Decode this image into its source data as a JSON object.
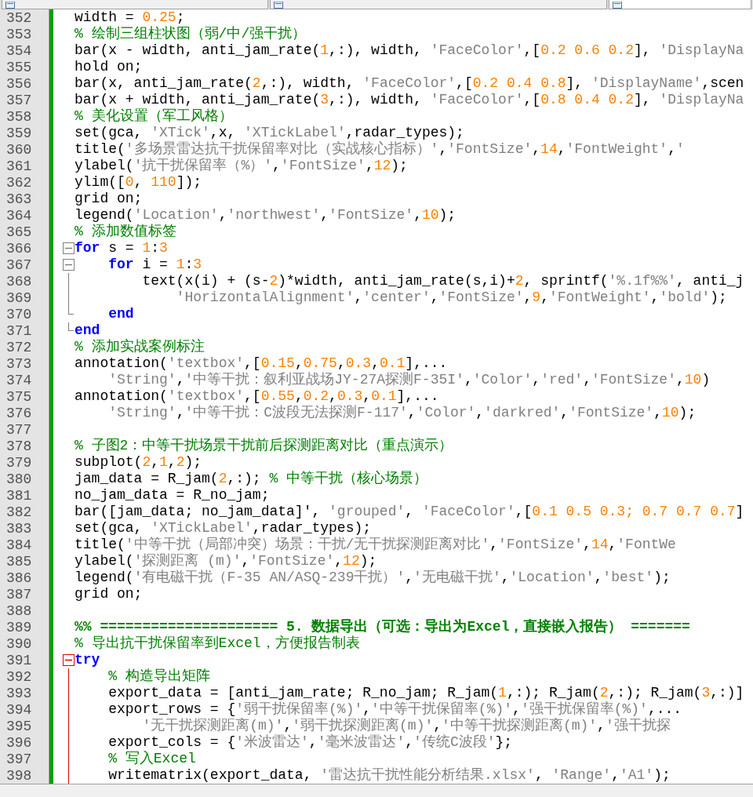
{
  "tabs": [
    {
      "selected": false
    },
    {
      "selected": false
    },
    {
      "selected": true
    }
  ],
  "lines": [
    {
      "number": "352",
      "tokens": [
        {
          "kind": "plain",
          "text": "width = "
        },
        {
          "kind": "num",
          "text": "0.25"
        },
        {
          "kind": "plain",
          "text": ";"
        }
      ]
    },
    {
      "number": "353",
      "tokens": [
        {
          "kind": "cmt",
          "text": "% 绘制三组柱状图（弱/中/强干扰）"
        }
      ]
    },
    {
      "number": "354",
      "tokens": [
        {
          "kind": "plain",
          "text": "bar(x - width, anti_jam_rate("
        },
        {
          "kind": "num",
          "text": "1"
        },
        {
          "kind": "plain",
          "text": ",:), width, "
        },
        {
          "kind": "str",
          "text": "'FaceColor'"
        },
        {
          "kind": "plain",
          "text": ",["
        },
        {
          "kind": "num",
          "text": "0.2 0.6 0.2"
        },
        {
          "kind": "plain",
          "text": "], "
        },
        {
          "kind": "str",
          "text": "'DisplayNa"
        }
      ]
    },
    {
      "number": "355",
      "tokens": [
        {
          "kind": "plain",
          "text": "hold on;"
        }
      ]
    },
    {
      "number": "356",
      "tokens": [
        {
          "kind": "plain",
          "text": "bar(x, anti_jam_rate("
        },
        {
          "kind": "num",
          "text": "2"
        },
        {
          "kind": "plain",
          "text": ",:), width, "
        },
        {
          "kind": "str",
          "text": "'FaceColor'"
        },
        {
          "kind": "plain",
          "text": ",["
        },
        {
          "kind": "num",
          "text": "0.2 0.4 0.8"
        },
        {
          "kind": "plain",
          "text": "], "
        },
        {
          "kind": "str",
          "text": "'DisplayName'"
        },
        {
          "kind": "plain",
          "text": ",scen"
        }
      ]
    },
    {
      "number": "357",
      "tokens": [
        {
          "kind": "plain",
          "text": "bar(x + width, anti_jam_rate("
        },
        {
          "kind": "num",
          "text": "3"
        },
        {
          "kind": "plain",
          "text": ",:), width, "
        },
        {
          "kind": "str",
          "text": "'FaceColor'"
        },
        {
          "kind": "plain",
          "text": ",["
        },
        {
          "kind": "num",
          "text": "0.8 0.4 0.2"
        },
        {
          "kind": "plain",
          "text": "], "
        },
        {
          "kind": "str",
          "text": "'DisplayNa"
        }
      ]
    },
    {
      "number": "358",
      "tokens": [
        {
          "kind": "cmt",
          "text": "% 美化设置（军工风格）"
        }
      ]
    },
    {
      "number": "359",
      "tokens": [
        {
          "kind": "plain",
          "text": "set(gca, "
        },
        {
          "kind": "str",
          "text": "'XTick'"
        },
        {
          "kind": "plain",
          "text": ",x, "
        },
        {
          "kind": "str",
          "text": "'XTickLabel'"
        },
        {
          "kind": "plain",
          "text": ",radar_types);"
        }
      ]
    },
    {
      "number": "360",
      "tokens": [
        {
          "kind": "plain",
          "text": "title("
        },
        {
          "kind": "str",
          "text": "'多场景雷达抗干扰保留率对比（实战核心指标）'"
        },
        {
          "kind": "plain",
          "text": ","
        },
        {
          "kind": "str",
          "text": "'FontSize'"
        },
        {
          "kind": "plain",
          "text": ","
        },
        {
          "kind": "num",
          "text": "14"
        },
        {
          "kind": "plain",
          "text": ","
        },
        {
          "kind": "str",
          "text": "'FontWeight'"
        },
        {
          "kind": "plain",
          "text": ","
        },
        {
          "kind": "str",
          "text": "'"
        }
      ]
    },
    {
      "number": "361",
      "tokens": [
        {
          "kind": "plain",
          "text": "ylabel("
        },
        {
          "kind": "str",
          "text": "'抗干扰保留率（%）'"
        },
        {
          "kind": "plain",
          "text": ","
        },
        {
          "kind": "str",
          "text": "'FontSize'"
        },
        {
          "kind": "plain",
          "text": ","
        },
        {
          "kind": "num",
          "text": "12"
        },
        {
          "kind": "plain",
          "text": ");"
        }
      ]
    },
    {
      "number": "362",
      "tokens": [
        {
          "kind": "plain",
          "text": "ylim(["
        },
        {
          "kind": "num",
          "text": "0"
        },
        {
          "kind": "plain",
          "text": ", "
        },
        {
          "kind": "num",
          "text": "110"
        },
        {
          "kind": "plain",
          "text": "]);"
        }
      ]
    },
    {
      "number": "363",
      "tokens": [
        {
          "kind": "plain",
          "text": "grid on;"
        }
      ]
    },
    {
      "number": "364",
      "tokens": [
        {
          "kind": "plain",
          "text": "legend("
        },
        {
          "kind": "str",
          "text": "'Location'"
        },
        {
          "kind": "plain",
          "text": ","
        },
        {
          "kind": "str",
          "text": "'northwest'"
        },
        {
          "kind": "plain",
          "text": ","
        },
        {
          "kind": "str",
          "text": "'FontSize'"
        },
        {
          "kind": "plain",
          "text": ","
        },
        {
          "kind": "num",
          "text": "10"
        },
        {
          "kind": "plain",
          "text": ");"
        }
      ]
    },
    {
      "number": "365",
      "tokens": [
        {
          "kind": "cmt",
          "text": "% 添加数值标签"
        }
      ]
    },
    {
      "number": "366",
      "fold": {
        "kind": "start",
        "active": false
      },
      "tokens": [
        {
          "kind": "kw",
          "text": "for"
        },
        {
          "kind": "plain",
          "text": " s = "
        },
        {
          "kind": "num",
          "text": "1"
        },
        {
          "kind": "plain",
          "text": ":"
        },
        {
          "kind": "num",
          "text": "3"
        }
      ]
    },
    {
      "number": "367",
      "fold": {
        "kind": "start",
        "active": false
      },
      "tokens": [
        {
          "kind": "kw",
          "text": "    for"
        },
        {
          "kind": "plain",
          "text": " i = "
        },
        {
          "kind": "num",
          "text": "1"
        },
        {
          "kind": "plain",
          "text": ":"
        },
        {
          "kind": "num",
          "text": "3"
        }
      ]
    },
    {
      "number": "368",
      "tokens": [
        {
          "kind": "plain",
          "text": "        text(x(i) + (s-"
        },
        {
          "kind": "num",
          "text": "2"
        },
        {
          "kind": "plain",
          "text": ")*width, anti_jam_rate(s,i)+"
        },
        {
          "kind": "num",
          "text": "2"
        },
        {
          "kind": "plain",
          "text": ", sprintf("
        },
        {
          "kind": "str",
          "text": "'%.1f%%'"
        },
        {
          "kind": "plain",
          "text": ", anti_j"
        }
      ]
    },
    {
      "number": "369",
      "tokens": [
        {
          "kind": "str",
          "text": "            'HorizontalAlignment'"
        },
        {
          "kind": "plain",
          "text": ","
        },
        {
          "kind": "str",
          "text": "'center'"
        },
        {
          "kind": "plain",
          "text": ","
        },
        {
          "kind": "str",
          "text": "'FontSize'"
        },
        {
          "kind": "plain",
          "text": ","
        },
        {
          "kind": "num",
          "text": "9"
        },
        {
          "kind": "plain",
          "text": ","
        },
        {
          "kind": "str",
          "text": "'FontWeight'"
        },
        {
          "kind": "plain",
          "text": ","
        },
        {
          "kind": "str",
          "text": "'bold'"
        },
        {
          "kind": "plain",
          "text": ");"
        }
      ]
    },
    {
      "number": "370",
      "fold": {
        "kind": "end",
        "active": false
      },
      "tokens": [
        {
          "kind": "kw",
          "text": "    end"
        }
      ]
    },
    {
      "number": "371",
      "fold": {
        "kind": "end",
        "active": false
      },
      "tokens": [
        {
          "kind": "kw",
          "text": "end"
        }
      ]
    },
    {
      "number": "372",
      "tokens": [
        {
          "kind": "cmt",
          "text": "% 添加实战案例标注"
        }
      ]
    },
    {
      "number": "373",
      "tokens": [
        {
          "kind": "plain",
          "text": "annotation("
        },
        {
          "kind": "str",
          "text": "'textbox'"
        },
        {
          "kind": "plain",
          "text": ",["
        },
        {
          "kind": "num",
          "text": "0.15"
        },
        {
          "kind": "plain",
          "text": ","
        },
        {
          "kind": "num",
          "text": "0.75"
        },
        {
          "kind": "plain",
          "text": ","
        },
        {
          "kind": "num",
          "text": "0.3"
        },
        {
          "kind": "plain",
          "text": ","
        },
        {
          "kind": "num",
          "text": "0.1"
        },
        {
          "kind": "plain",
          "text": "],..."
        }
      ]
    },
    {
      "number": "374",
      "tokens": [
        {
          "kind": "str",
          "text": "    'String'"
        },
        {
          "kind": "plain",
          "text": ","
        },
        {
          "kind": "str",
          "text": "'中等干扰：叙利亚战场JY-27A探测F-35I'"
        },
        {
          "kind": "plain",
          "text": ","
        },
        {
          "kind": "str",
          "text": "'Color'"
        },
        {
          "kind": "plain",
          "text": ","
        },
        {
          "kind": "str",
          "text": "'red'"
        },
        {
          "kind": "plain",
          "text": ","
        },
        {
          "kind": "str",
          "text": "'FontSize'"
        },
        {
          "kind": "plain",
          "text": ","
        },
        {
          "kind": "num",
          "text": "10"
        },
        {
          "kind": "plain",
          "text": ")"
        }
      ]
    },
    {
      "number": "375",
      "tokens": [
        {
          "kind": "plain",
          "text": "annotation("
        },
        {
          "kind": "str",
          "text": "'textbox'"
        },
        {
          "kind": "plain",
          "text": ",["
        },
        {
          "kind": "num",
          "text": "0.55"
        },
        {
          "kind": "plain",
          "text": ","
        },
        {
          "kind": "num",
          "text": "0.2"
        },
        {
          "kind": "plain",
          "text": ","
        },
        {
          "kind": "num",
          "text": "0.3"
        },
        {
          "kind": "plain",
          "text": ","
        },
        {
          "kind": "num",
          "text": "0.1"
        },
        {
          "kind": "plain",
          "text": "],..."
        }
      ]
    },
    {
      "number": "376",
      "tokens": [
        {
          "kind": "str",
          "text": "    'String'"
        },
        {
          "kind": "plain",
          "text": ","
        },
        {
          "kind": "str",
          "text": "'中等干扰：C波段无法探测F-117'"
        },
        {
          "kind": "plain",
          "text": ","
        },
        {
          "kind": "str",
          "text": "'Color'"
        },
        {
          "kind": "plain",
          "text": ","
        },
        {
          "kind": "str",
          "text": "'darkred'"
        },
        {
          "kind": "plain",
          "text": ","
        },
        {
          "kind": "str",
          "text": "'FontSize'"
        },
        {
          "kind": "plain",
          "text": ","
        },
        {
          "kind": "num",
          "text": "10"
        },
        {
          "kind": "plain",
          "text": ");"
        }
      ]
    },
    {
      "number": "377"
    },
    {
      "number": "378",
      "tokens": [
        {
          "kind": "cmt",
          "text": "% 子图2：中等干扰场景干扰前后探测距离对比（重点演示）"
        }
      ]
    },
    {
      "number": "379",
      "tokens": [
        {
          "kind": "plain",
          "text": "subplot("
        },
        {
          "kind": "num",
          "text": "2"
        },
        {
          "kind": "plain",
          "text": ","
        },
        {
          "kind": "num",
          "text": "1"
        },
        {
          "kind": "plain",
          "text": ","
        },
        {
          "kind": "num",
          "text": "2"
        },
        {
          "kind": "plain",
          "text": ");"
        }
      ]
    },
    {
      "number": "380",
      "tokens": [
        {
          "kind": "plain",
          "text": "jam_data = R_jam("
        },
        {
          "kind": "num",
          "text": "2"
        },
        {
          "kind": "plain",
          "text": ",:); "
        },
        {
          "kind": "cmt",
          "text": "% 中等干扰（核心场景）"
        }
      ]
    },
    {
      "number": "381",
      "tokens": [
        {
          "kind": "plain",
          "text": "no_jam_data = R_no_jam;"
        }
      ]
    },
    {
      "number": "382",
      "tokens": [
        {
          "kind": "plain",
          "text": "bar([jam_data; no_jam_data]', "
        },
        {
          "kind": "str",
          "text": "'grouped'"
        },
        {
          "kind": "plain",
          "text": ", "
        },
        {
          "kind": "str",
          "text": "'FaceColor'"
        },
        {
          "kind": "plain",
          "text": ",["
        },
        {
          "kind": "num",
          "text": "0.1 0.5 0.3; 0.7 0.7 0.7"
        },
        {
          "kind": "plain",
          "text": "]"
        }
      ]
    },
    {
      "number": "383",
      "tokens": [
        {
          "kind": "plain",
          "text": "set(gca, "
        },
        {
          "kind": "str",
          "text": "'XTickLabel'"
        },
        {
          "kind": "plain",
          "text": ",radar_types);"
        }
      ]
    },
    {
      "number": "384",
      "tokens": [
        {
          "kind": "plain",
          "text": "title("
        },
        {
          "kind": "str",
          "text": "'中等干扰（局部冲突）场景：干扰/无干扰探测距离对比'"
        },
        {
          "kind": "plain",
          "text": ","
        },
        {
          "kind": "str",
          "text": "'FontSize'"
        },
        {
          "kind": "plain",
          "text": ","
        },
        {
          "kind": "num",
          "text": "14"
        },
        {
          "kind": "plain",
          "text": ","
        },
        {
          "kind": "str",
          "text": "'FontWe"
        }
      ]
    },
    {
      "number": "385",
      "tokens": [
        {
          "kind": "plain",
          "text": "ylabel("
        },
        {
          "kind": "str",
          "text": "'探测距离 (m)'"
        },
        {
          "kind": "plain",
          "text": ","
        },
        {
          "kind": "str",
          "text": "'FontSize'"
        },
        {
          "kind": "plain",
          "text": ","
        },
        {
          "kind": "num",
          "text": "12"
        },
        {
          "kind": "plain",
          "text": ");"
        }
      ]
    },
    {
      "number": "386",
      "tokens": [
        {
          "kind": "plain",
          "text": "legend("
        },
        {
          "kind": "str",
          "text": "'有电磁干扰（F-35 AN/ASQ-239干扰）'"
        },
        {
          "kind": "plain",
          "text": ","
        },
        {
          "kind": "str",
          "text": "'无电磁干扰'"
        },
        {
          "kind": "plain",
          "text": ","
        },
        {
          "kind": "str",
          "text": "'Location'"
        },
        {
          "kind": "plain",
          "text": ","
        },
        {
          "kind": "str",
          "text": "'best'"
        },
        {
          "kind": "plain",
          "text": ");"
        }
      ]
    },
    {
      "number": "387",
      "tokens": [
        {
          "kind": "plain",
          "text": "grid on;"
        }
      ]
    },
    {
      "number": "388"
    },
    {
      "number": "389",
      "tokens": [
        {
          "kind": "section",
          "text": "%% ===================== 5. 数据导出（可选：导出为Excel，直接嵌入报告） ======="
        }
      ]
    },
    {
      "number": "390",
      "tokens": [
        {
          "kind": "cmt",
          "text": "% 导出抗干扰保留率到Excel，方便报告制表"
        }
      ]
    },
    {
      "number": "391",
      "fold": {
        "kind": "start",
        "active": true
      },
      "tokens": [
        {
          "kind": "kw",
          "text": "try"
        }
      ]
    },
    {
      "number": "392",
      "tokens": [
        {
          "kind": "cmt",
          "text": "    % 构造导出矩阵"
        }
      ]
    },
    {
      "number": "393",
      "tokens": [
        {
          "kind": "plain",
          "text": "    export_data = [anti_jam_rate; R_no_jam; R_jam("
        },
        {
          "kind": "num",
          "text": "1"
        },
        {
          "kind": "plain",
          "text": ",:); R_jam("
        },
        {
          "kind": "num",
          "text": "2"
        },
        {
          "kind": "plain",
          "text": ",:); R_jam("
        },
        {
          "kind": "num",
          "text": "3"
        },
        {
          "kind": "plain",
          "text": ",:)]"
        }
      ]
    },
    {
      "number": "394",
      "tokens": [
        {
          "kind": "plain",
          "text": "    export_rows = {"
        },
        {
          "kind": "str",
          "text": "'弱干扰保留率(%)'"
        },
        {
          "kind": "plain",
          "text": ","
        },
        {
          "kind": "str",
          "text": "'中等干扰保留率(%)'"
        },
        {
          "kind": "plain",
          "text": ","
        },
        {
          "kind": "str",
          "text": "'强干扰保留率(%)'"
        },
        {
          "kind": "plain",
          "text": ",..."
        }
      ]
    },
    {
      "number": "395",
      "tokens": [
        {
          "kind": "str",
          "text": "        '无干扰探测距离(m)'"
        },
        {
          "kind": "plain",
          "text": ","
        },
        {
          "kind": "str",
          "text": "'弱干扰探测距离(m)'"
        },
        {
          "kind": "plain",
          "text": ","
        },
        {
          "kind": "str",
          "text": "'中等干扰探测距离(m)'"
        },
        {
          "kind": "plain",
          "text": ","
        },
        {
          "kind": "str",
          "text": "'强干扰探"
        }
      ]
    },
    {
      "number": "396",
      "tokens": [
        {
          "kind": "plain",
          "text": "    export_cols = {"
        },
        {
          "kind": "str",
          "text": "'米波雷达'"
        },
        {
          "kind": "plain",
          "text": ","
        },
        {
          "kind": "str",
          "text": "'毫米波雷达'"
        },
        {
          "kind": "plain",
          "text": ","
        },
        {
          "kind": "str",
          "text": "'传统C波段'"
        },
        {
          "kind": "plain",
          "text": "};"
        }
      ]
    },
    {
      "number": "397",
      "tokens": [
        {
          "kind": "cmt",
          "text": "    % 写入Excel"
        }
      ]
    },
    {
      "number": "398",
      "tokens": [
        {
          "kind": "plain",
          "text": "    writematrix(export_data, "
        },
        {
          "kind": "str",
          "text": "'雷达抗干扰性能分析结果.xlsx'"
        },
        {
          "kind": "plain",
          "text": ", "
        },
        {
          "kind": "str",
          "text": "'Range'"
        },
        {
          "kind": "plain",
          "text": ","
        },
        {
          "kind": "str",
          "text": "'A1'"
        },
        {
          "kind": "plain",
          "text": ");"
        }
      ]
    }
  ]
}
